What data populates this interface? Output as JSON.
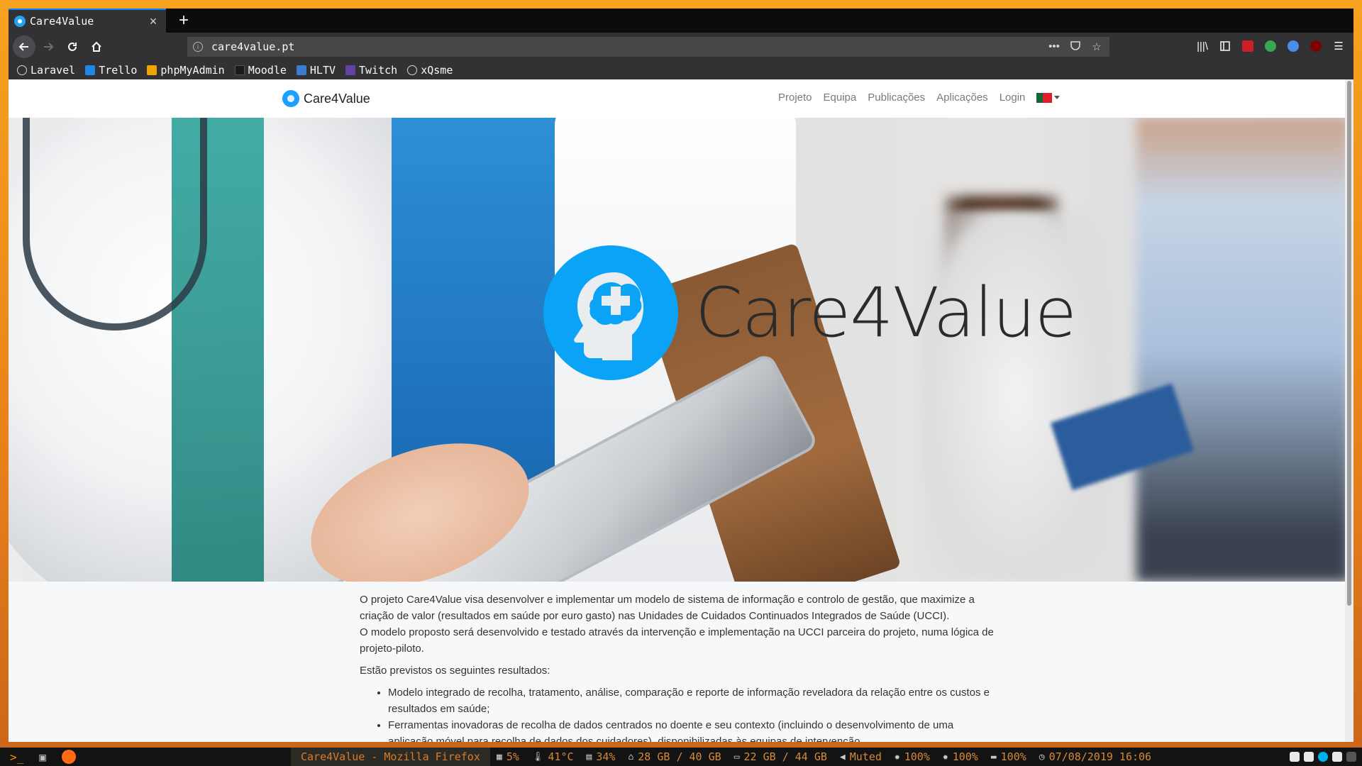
{
  "browser": {
    "tab_title": "Care4Value",
    "tab_close": "×",
    "new_tab": "+",
    "url": "care4value.pt",
    "bookmarks": [
      {
        "label": "Laravel",
        "color": "#d7d7db"
      },
      {
        "label": "Trello",
        "color": "#1e88e5"
      },
      {
        "label": "phpMyAdmin",
        "color": "#f0a500"
      },
      {
        "label": "Moodle",
        "color": "#1a1a1a"
      },
      {
        "label": "HLTV",
        "color": "#3b7bd1"
      },
      {
        "label": "Twitch",
        "color": "#6441a5"
      },
      {
        "label": "xQsme",
        "color": "#d7d7db"
      }
    ]
  },
  "site": {
    "brand": "Care4Value",
    "nav": [
      "Projeto",
      "Equipa",
      "Publicações",
      "Aplicações",
      "Login"
    ],
    "hero_title": "Care4Value",
    "intro_1": "O projeto Care4Value visa desenvolver e implementar um modelo de sistema de informação e controlo de gestão, que maximize a criação de valor (resultados em saúde por euro gasto) nas Unidades de Cuidados Continuados Integrados de Saúde (UCCI).",
    "intro_2": "O modelo proposto será desenvolvido e testado através da intervenção e implementação na UCCI parceira do projeto, numa lógica de projeto-piloto.",
    "results_heading": "Estão previstos os seguintes resultados:",
    "results": [
      "Modelo integrado de recolha, tratamento, análise, comparação e reporte de informação reveladora da relação entre os custos e resultados em saúde;",
      "Ferramentas inovadoras de recolha de dados centrados no doente e seu contexto (incluindo o desenvolvimento de uma aplicação móvel para recolha de dados dos cuidadores), disponibilizadas às equipas de intervenção."
    ],
    "accent_color": "#0aa3f5"
  },
  "taskbar": {
    "window_title": "Care4Value - Mozilla Firefox",
    "cpu": "5%",
    "temp": "41°C",
    "mem": "34%",
    "home_disk": "28 GB / 40 GB",
    "root_disk": "22 GB / 44 GB",
    "volume": "Muted",
    "brightness1": "100%",
    "brightness2": "100%",
    "battery": "100%",
    "datetime": "07/08/2019 16:06"
  }
}
